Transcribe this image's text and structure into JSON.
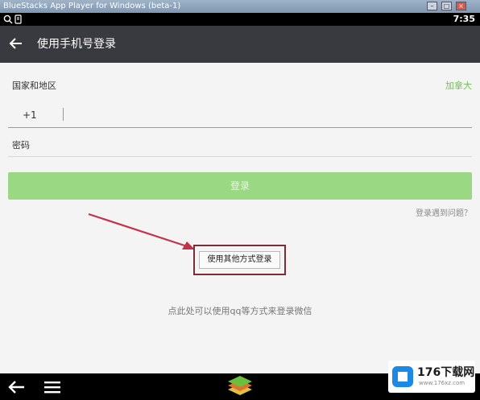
{
  "window": {
    "title": "BlueStacks App Player for Windows (beta-1)"
  },
  "status_bar": {
    "time": "7:35"
  },
  "toolbar": {
    "title": "使用手机号登录"
  },
  "form": {
    "country_label": "国家和地区",
    "country_value": "加拿大",
    "country_code": "+1",
    "phone_placeholder": "",
    "password_label": "密码",
    "password_placeholder": ""
  },
  "login_button": {
    "label": "登录"
  },
  "trouble_link": "登录遇到问题？",
  "other_method_button": "使用其他方式登录",
  "hint": "点此处可以使用qq等方式来登录微信",
  "watermark": {
    "text": "176下载网",
    "url": "www.176xz.com"
  },
  "colors": {
    "toolbar": "#393a3f",
    "accent_green": "#9ad884",
    "highlight_box": "#7a2c37",
    "arrow": "#c2324a"
  },
  "icons": [
    "search-icon",
    "notification-icon",
    "back-arrow-icon",
    "back-nav-icon",
    "menu-icon",
    "bluestacks-logo-icon"
  ]
}
